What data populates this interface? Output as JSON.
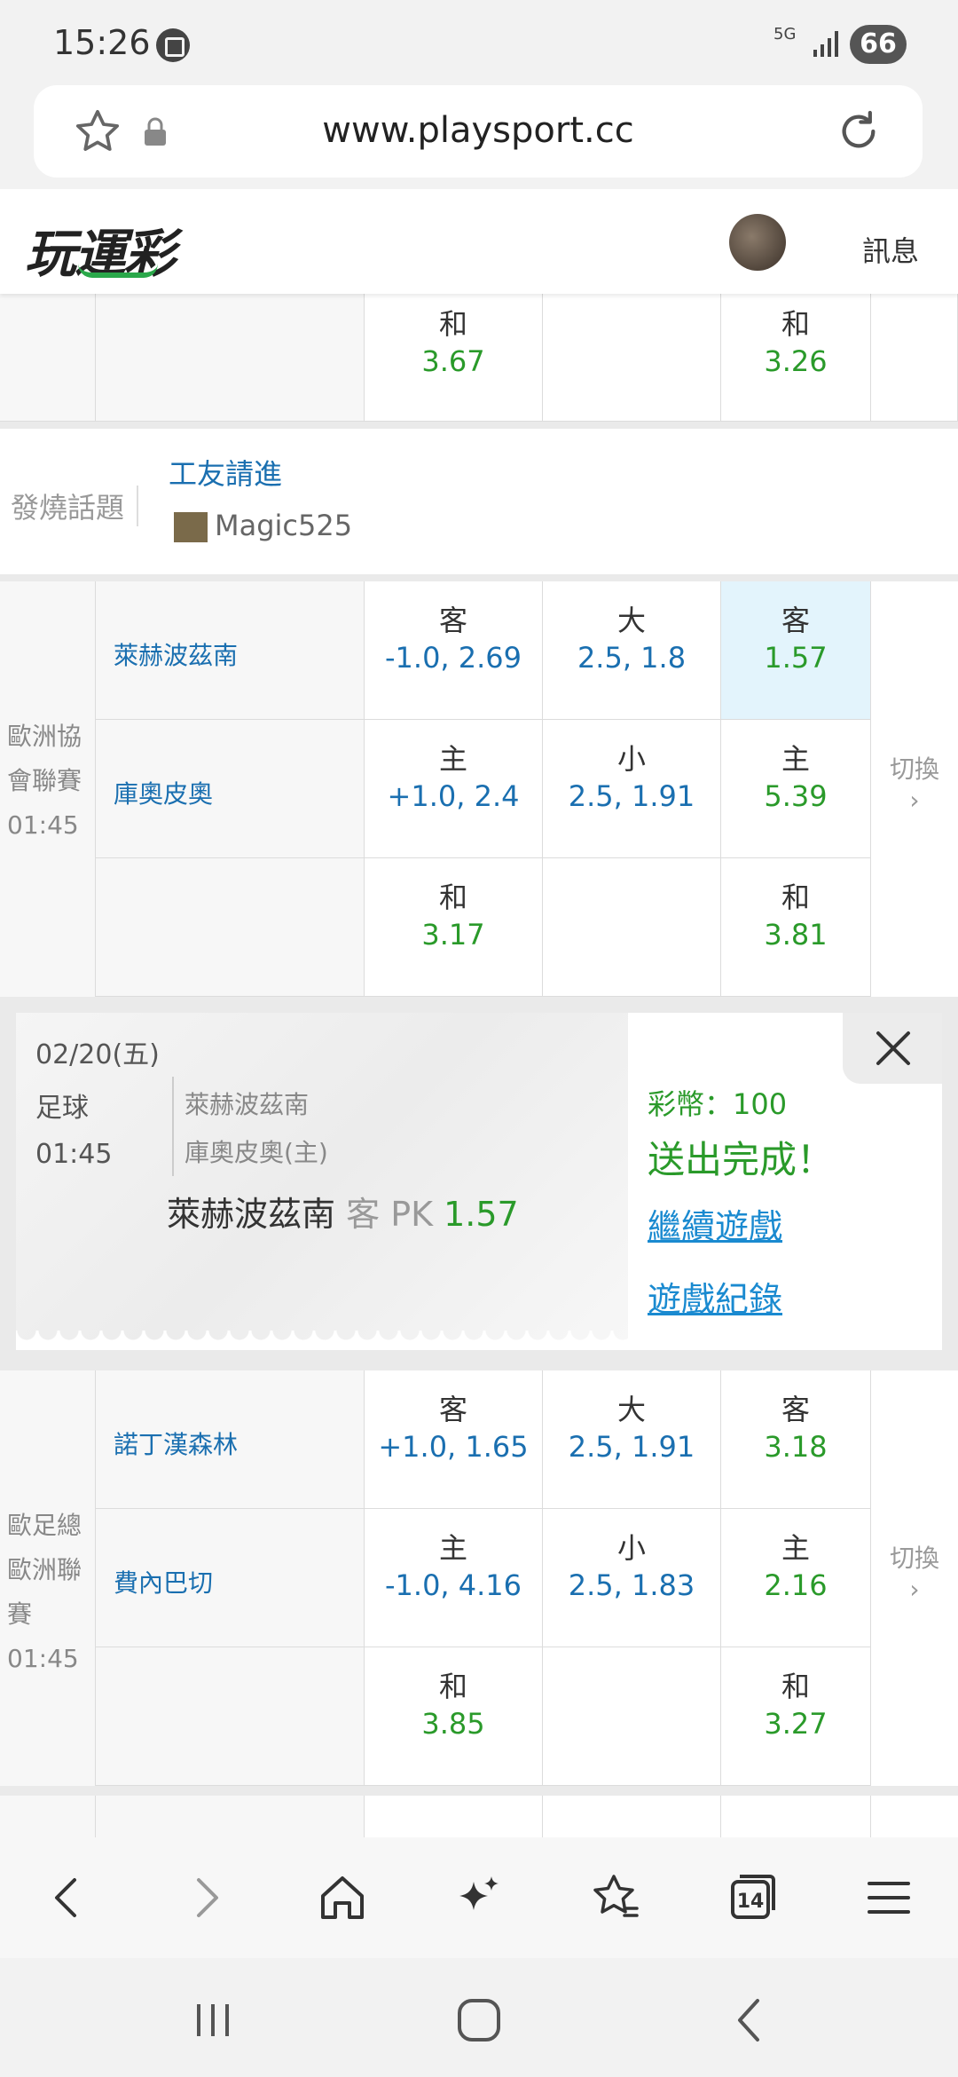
{
  "status": {
    "time": "15:26",
    "network": "5G",
    "battery": "66"
  },
  "browser": {
    "url": "www.playsport.cc"
  },
  "site": {
    "logo": "玩運彩",
    "message_label": "訊息"
  },
  "top_partial": {
    "col_a": {
      "label": "和",
      "value": "3.67"
    },
    "col_c": {
      "label": "和",
      "value": "3.26"
    }
  },
  "topic": {
    "label": "發燒話題",
    "title": "工友請進",
    "user": "Magic525"
  },
  "match1": {
    "league_line1": "歐洲協",
    "league_line2": "會聯賽",
    "time": "01:45",
    "team_away": "萊赫波茲南",
    "team_home": "庫奧皮奧",
    "switch_label": "切換",
    "rows": [
      {
        "a_label": "客",
        "a_value": "-1.0, 2.69",
        "b_label": "大",
        "b_value": "2.5, 1.8",
        "c_label": "客",
        "c_value": "1.57"
      },
      {
        "a_label": "主",
        "a_value": "+1.0, 2.4",
        "b_label": "小",
        "b_value": "2.5, 1.91",
        "c_label": "主",
        "c_value": "5.39"
      },
      {
        "a_label": "和",
        "a_value": "3.17",
        "b_label": "",
        "b_value": "",
        "c_label": "和",
        "c_value": "3.81"
      }
    ]
  },
  "popup": {
    "date": "02/20(五)",
    "sport": "足球",
    "time": "01:45",
    "team1": "萊赫波茲南",
    "team2": "庫奧皮奧(主)",
    "bet_team": "萊赫波茲南",
    "bet_type": "客 PK",
    "bet_odds": "1.57",
    "coins": "彩幣：100",
    "done": "送出完成！",
    "continue_link": "繼續遊戲",
    "record_link": "遊戲紀錄"
  },
  "match2": {
    "league_line1": "歐足總",
    "league_line2": "歐洲聯",
    "league_line3": "賽",
    "time": "01:45",
    "team_away": "諾丁漢森林",
    "team_home": "費內巴切",
    "switch_label": "切換",
    "rows": [
      {
        "a_label": "客",
        "a_value": "+1.0, 1.65",
        "b_label": "大",
        "b_value": "2.5, 1.91",
        "c_label": "客",
        "c_value": "3.18"
      },
      {
        "a_label": "主",
        "a_value": "-1.0, 4.16",
        "b_label": "小",
        "b_value": "2.5, 1.83",
        "c_label": "主",
        "c_value": "2.16"
      },
      {
        "a_label": "和",
        "a_value": "3.85",
        "b_label": "",
        "b_value": "",
        "c_label": "和",
        "c_value": "3.27"
      }
    ]
  },
  "toolbar": {
    "tabs_count": "14"
  }
}
